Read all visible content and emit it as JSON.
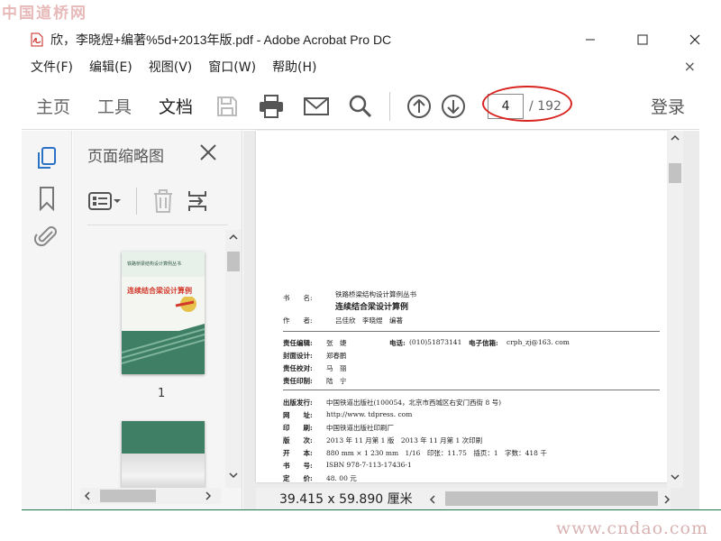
{
  "watermark_top": "中国道桥网",
  "watermark_bottom": "www.cndao.com",
  "window": {
    "title": "欣，李晓煜+编著%5d+2013年版.pdf - Adobe Acrobat Pro DC"
  },
  "menu": {
    "items": [
      "文件(F)",
      "编辑(E)",
      "视图(V)",
      "窗口(W)",
      "帮助(H)"
    ],
    "close": "×"
  },
  "toolbar": {
    "tabs": [
      "主页",
      "工具",
      "文档"
    ],
    "active_tab": "文档",
    "page_current": "4",
    "page_total": "/ 192",
    "login": "登录"
  },
  "thumbs_panel": {
    "title": "页面缩略图",
    "pages": [
      {
        "label": "1",
        "cover_title": "连续结合梁设计算例",
        "cover_series": "铁路桥梁结构设计算例丛书"
      },
      {
        "label": ""
      }
    ]
  },
  "status": {
    "dimensions": "39.415 x 59.890 厘米"
  },
  "copyright_page": {
    "book_label": "书　　名:",
    "series": "铁路桥梁结构设计算例丛书",
    "title": "连续结合梁设计算例",
    "author_label": "作　　者:",
    "authors": "吕佳欣　李晓煜　编著",
    "editor_label": "责任编辑:",
    "editor": "张　婕",
    "phone_label": "电话:",
    "phone": "(010)51873141",
    "email_label": "电子信箱:",
    "email": "crph_zj@163. com",
    "cover_label": "封面设计:",
    "cover": "郑春鹏",
    "proof_label": "责任校对:",
    "proof": "马　丽",
    "print_label": "责任印制:",
    "print_person": "陆　宁",
    "publisher_label": "出版发行:",
    "publisher": "中国铁道出版社(100054，北京市西城区右安门西街 8 号)",
    "url_label": "网　　址:",
    "url": "http://www. tdpress. com",
    "printer_label": "印　　刷:",
    "printer": "中国铁道出版社印刷厂",
    "edition_label": "版　　次:",
    "edition": "2013 年 11 月第 1 版　2013 年 11 月第 1 次印刷",
    "format_label": "开　　本:",
    "format": "880 mm × 1 230 mm　1/16　印张：11.75　插页：1　字数：418 千",
    "isbn_label": "书　　号:",
    "isbn": "ISBN 978-7-113-17436-1",
    "price_label": "定　　价:",
    "price": "48. 00 元"
  },
  "colors": {
    "annotation_red": "#d9231f",
    "accent_blue": "#2a72c8",
    "cover_green": "#3e7f66",
    "cover_red": "#d33a2c"
  }
}
